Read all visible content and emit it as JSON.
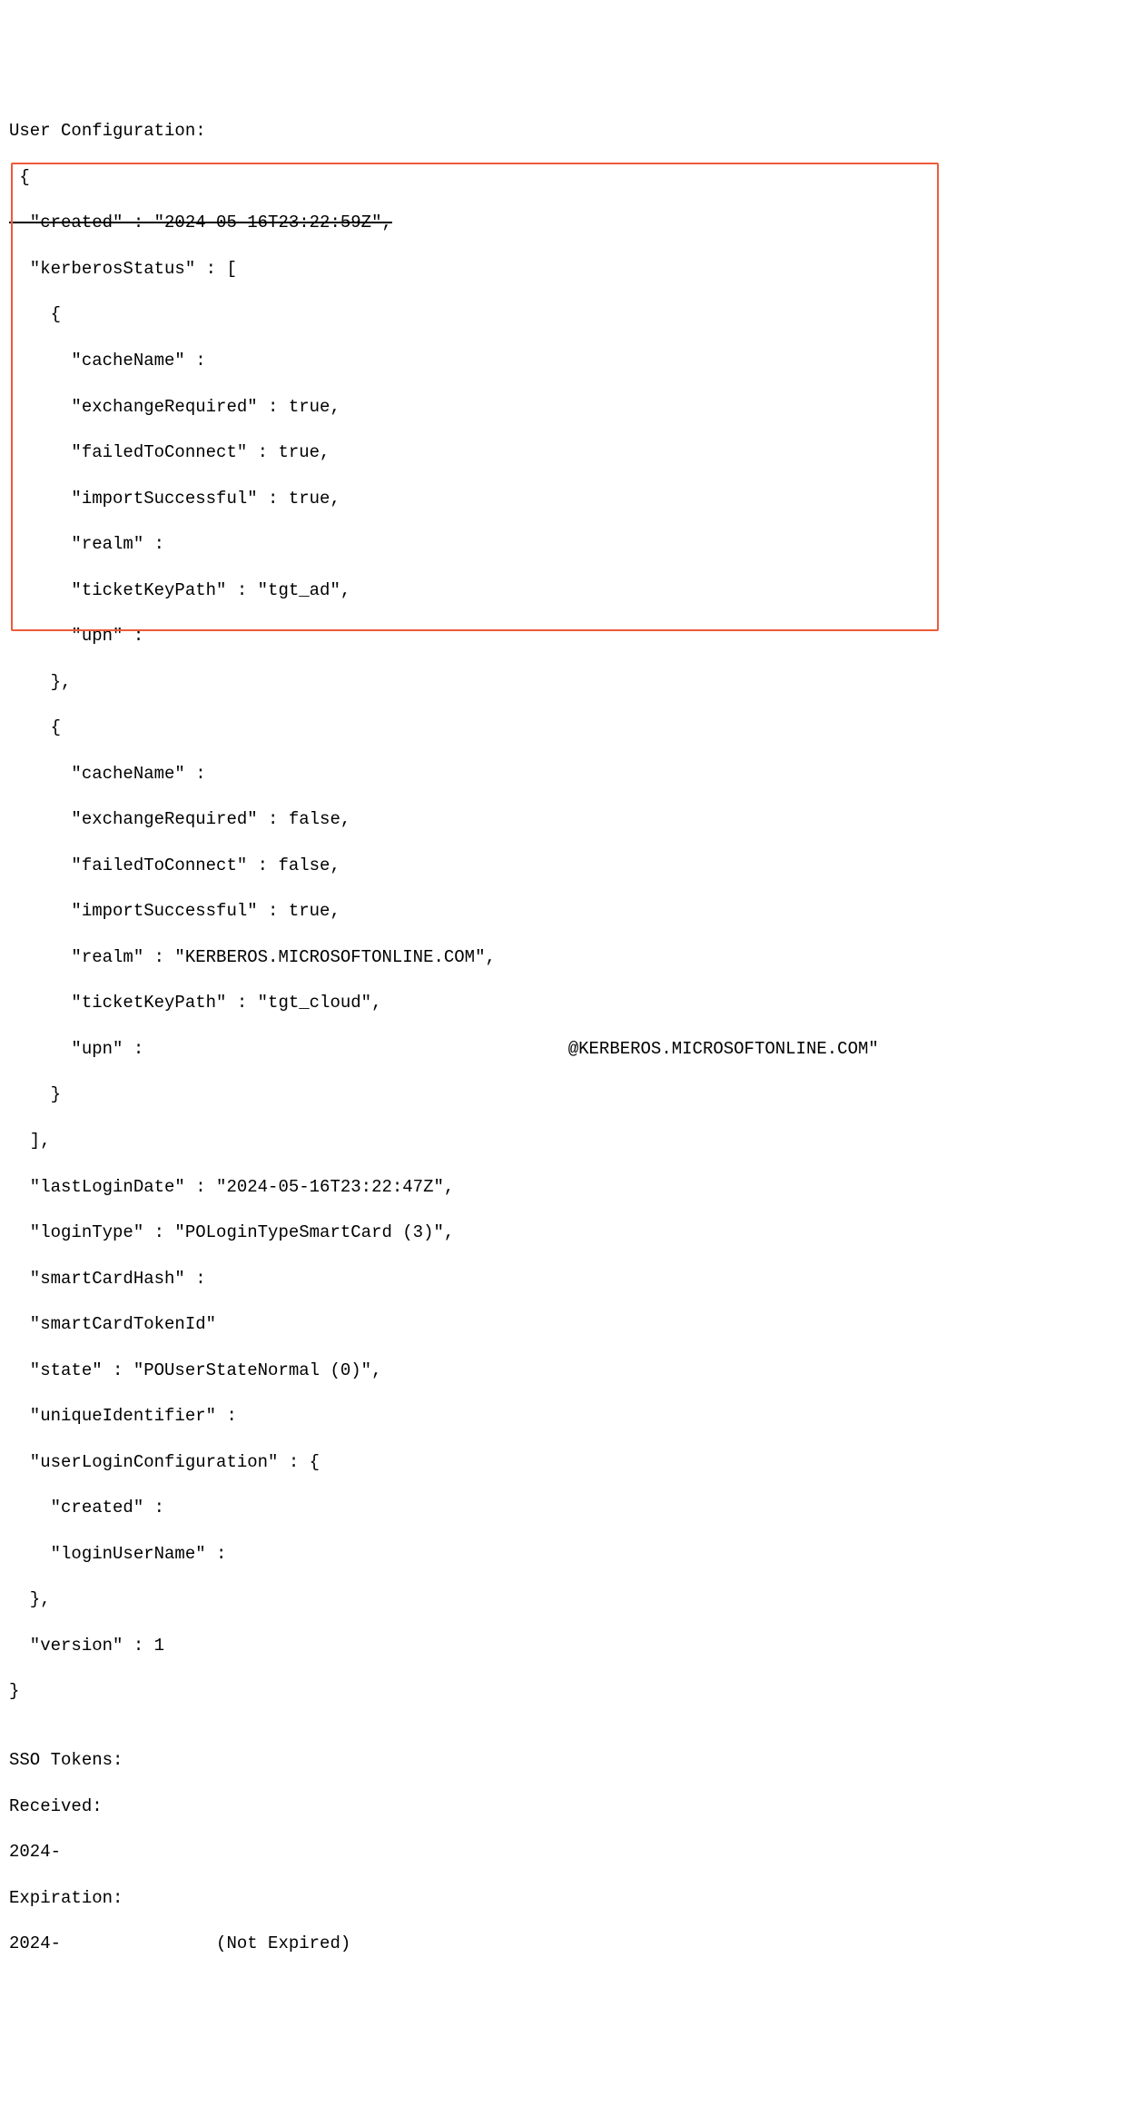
{
  "header": "User Configuration:",
  "json_open": " {",
  "created_line": "  \"created\" : \"2024-05-16T23:22:59Z\",",
  "kerberos_open": "  \"kerberosStatus\" : [",
  "kerb1": {
    "open": "    {",
    "cacheName": "      \"cacheName\" :",
    "exchangeRequired": "      \"exchangeRequired\" : true,",
    "failedToConnect": "      \"failedToConnect\" : true,",
    "importSuccessful": "      \"importSuccessful\" : true,",
    "realm": "      \"realm\" :",
    "ticketKeyPath": "      \"ticketKeyPath\" : \"tgt_ad\",",
    "upn": "      \"upn\" :",
    "close": "    },"
  },
  "kerb2": {
    "open": "    {",
    "cacheName": "      \"cacheName\" :",
    "exchangeRequired": "      \"exchangeRequired\" : false,",
    "failedToConnect": "      \"failedToConnect\" : false,",
    "importSuccessful": "      \"importSuccessful\" : true,",
    "realm": "      \"realm\" : \"KERBEROS.MICROSOFTONLINE.COM\",",
    "ticketKeyPath": "      \"ticketKeyPath\" : \"tgt_cloud\",",
    "upn_prefix": "      \"upn\" :",
    "upn_suffix": "@KERBEROS.MICROSOFTONLINE.COM\"",
    "close": "    }"
  },
  "kerberos_close": "  ],",
  "lastLoginDate": "  \"lastLoginDate\" : \"2024-05-16T23:22:47Z\",",
  "loginType": "  \"loginType\" : \"POLoginTypeSmartCard (3)\",",
  "smartCardHash": "  \"smartCardHash\" :",
  "smartCardTokenId": "  \"smartCardTokenId\"",
  "state": "  \"state\" : \"POUserStateNormal (0)\",",
  "uniqueIdentifier": "  \"uniqueIdentifier\" :",
  "ulc_open": "  \"userLoginConfiguration\" : {",
  "ulc_created": "    \"created\" :",
  "ulc_loginUserName": "    \"loginUserName\" :",
  "ulc_close": "  },",
  "version": "  \"version\" : 1",
  "json_close": "}",
  "blank": "",
  "sso_tokens": "SSO Tokens:",
  "received": "Received:",
  "received_date": "2024-",
  "expiration": "Expiration:",
  "expiration_line": "2024-               (Not Expired)"
}
